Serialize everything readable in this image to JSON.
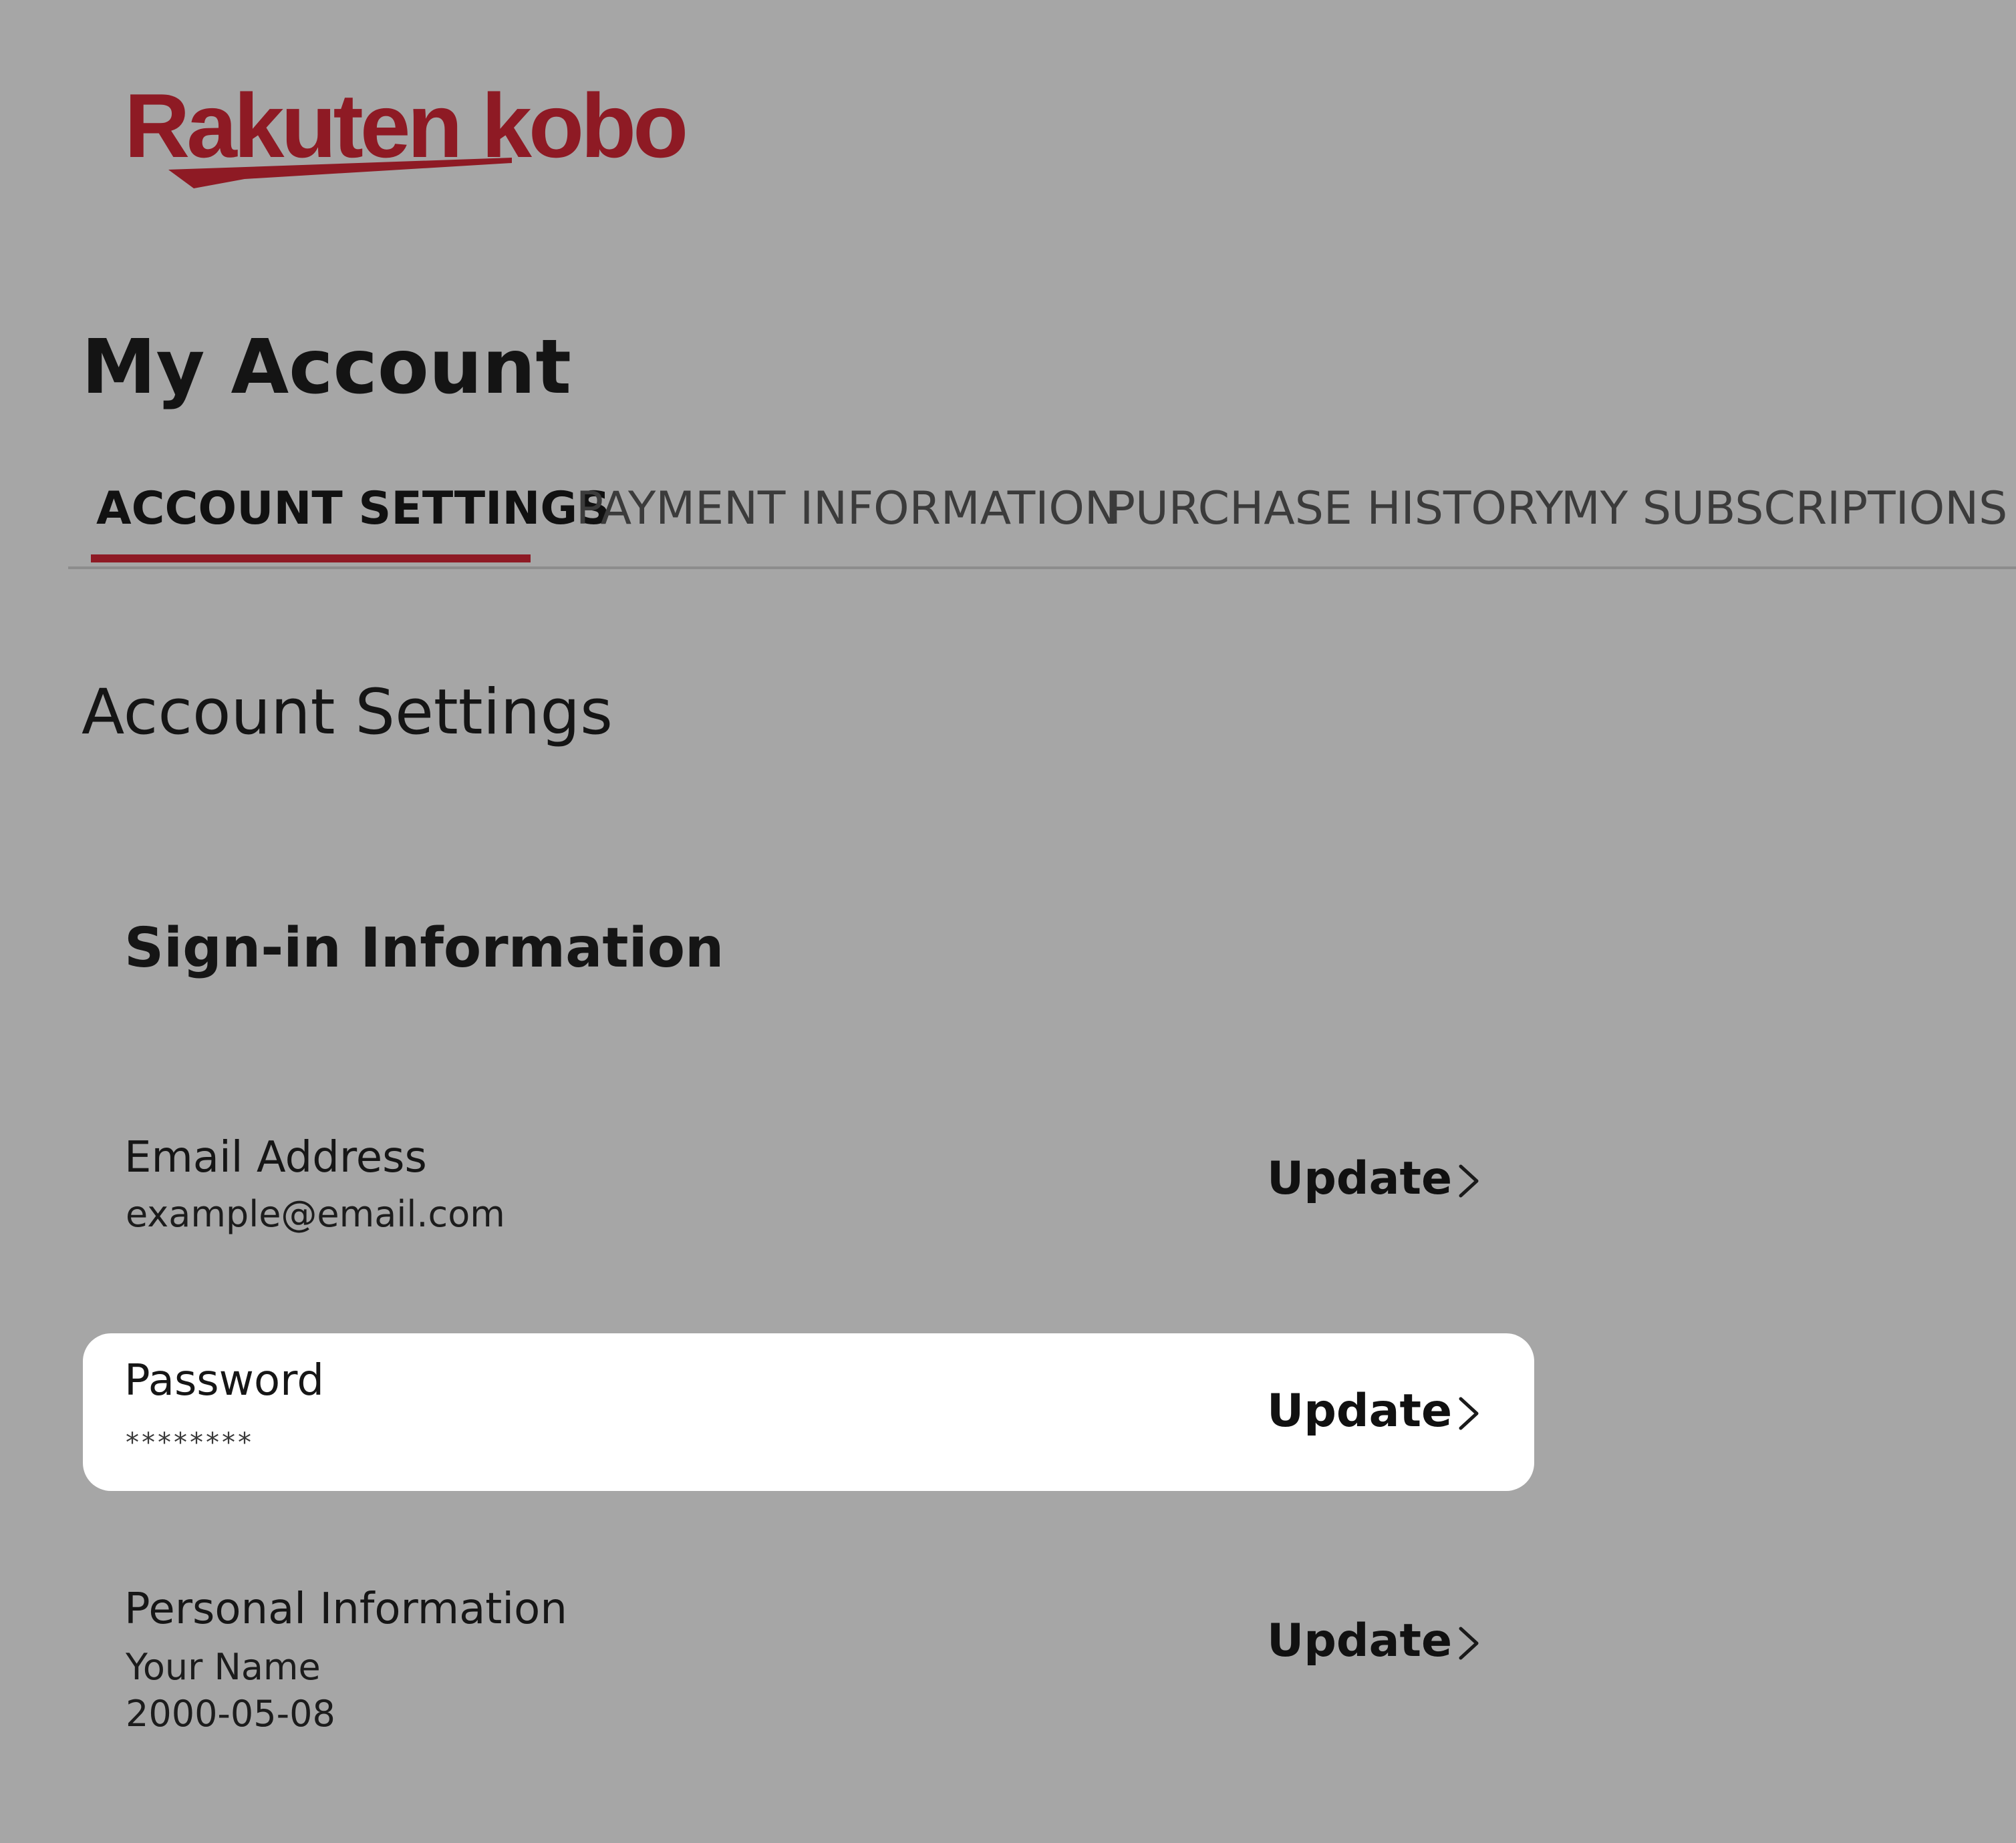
{
  "brand": {
    "logo_text": "Rakuten kobo",
    "logo_color": "#8e1a24"
  },
  "page": {
    "title": "My Account"
  },
  "tabs": [
    {
      "label": "ACCOUNT SETTINGS",
      "active": true
    },
    {
      "label": "PAYMENT INFORMATION",
      "active": false
    },
    {
      "label": "PURCHASE HISTORY",
      "active": false
    },
    {
      "label": "MY SUBSCRIPTIONS",
      "active": false
    }
  ],
  "section": {
    "title": "Account Settings",
    "subsection_title": "Sign-in Information"
  },
  "rows": [
    {
      "label": "Email Address",
      "values": [
        "example@email.com"
      ],
      "action_label": "Update",
      "action_icon": "chevron-right-icon",
      "highlighted": false
    },
    {
      "label": "Password",
      "values": [
        "********"
      ],
      "action_label": "Update",
      "action_icon": "chevron-right-icon",
      "highlighted": true
    },
    {
      "label": "Personal Information",
      "values": [
        "Your Name",
        "2000-05-08"
      ],
      "action_label": "Update",
      "action_icon": "chevron-right-icon",
      "highlighted": false
    }
  ],
  "colors": {
    "background": "#a6a6a6",
    "accent": "#8e1a24",
    "highlight_row": "#ffffff"
  }
}
